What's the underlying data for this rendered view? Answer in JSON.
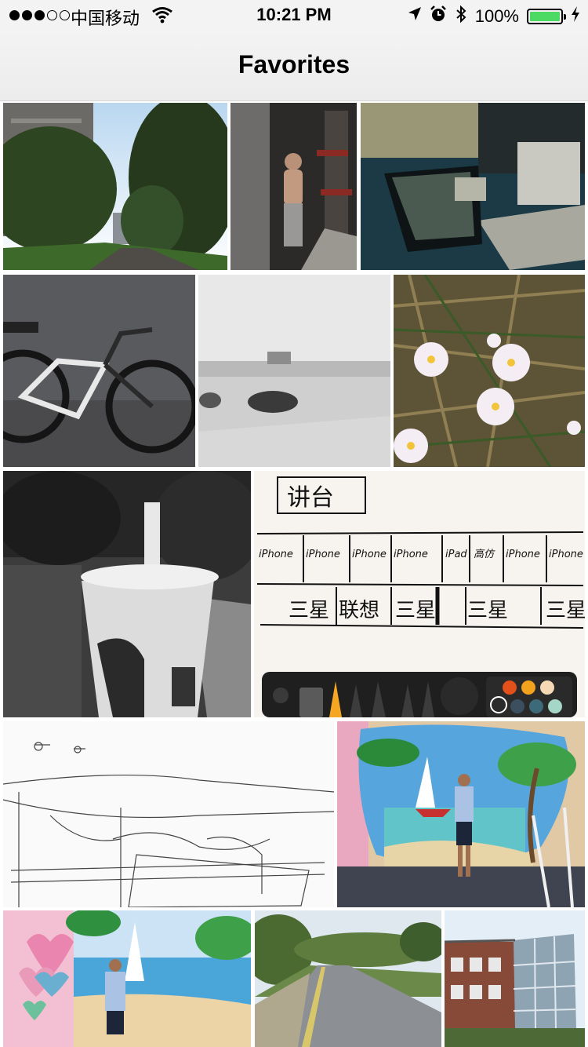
{
  "status_bar": {
    "carrier": "中国移动",
    "time": "10:21 PM",
    "battery_percent": "100%",
    "battery_level": 1.0,
    "signal_bars": 3,
    "signal_total": 5,
    "icons": [
      "wifi-icon",
      "location-arrow-icon",
      "alarm-clock-icon",
      "bluetooth-icon",
      "battery-icon",
      "charging-bolt-icon"
    ],
    "battery_color": "#4cd964"
  },
  "nav": {
    "title": "Favorites"
  },
  "grid": {
    "photo_count": 14,
    "photos": [
      {
        "subject": "tree-lined-road"
      },
      {
        "subject": "gym-mirror-selfie"
      },
      {
        "subject": "pc-case-and-laptop"
      },
      {
        "subject": "road-bike"
      },
      {
        "subject": "hazy-landscape"
      },
      {
        "subject": "white-flowers"
      },
      {
        "subject": "drink-cup-street"
      },
      {
        "subject": "whiteboard-sketch",
        "sketch": {
          "header": "讲台",
          "row1": [
            "iPhone",
            "iPhone",
            "iPhone",
            "iPhone",
            "iPad",
            "高仿",
            "iPhone",
            "iPhone"
          ],
          "row2": [
            "三星",
            "联想",
            "三星",
            "三星",
            "三星"
          ]
        },
        "palette_colors": [
          "#e2501c",
          "#f3a21d",
          "#f5d9b5",
          "#3c4f5e",
          "#3d6a78",
          "#a6d6c8"
        ]
      },
      {
        "subject": "pencil-sketch-room"
      },
      {
        "subject": "mural-photo"
      },
      {
        "subject": "mural-photo-2"
      },
      {
        "subject": "country-road"
      },
      {
        "subject": "glass-building"
      }
    ]
  }
}
